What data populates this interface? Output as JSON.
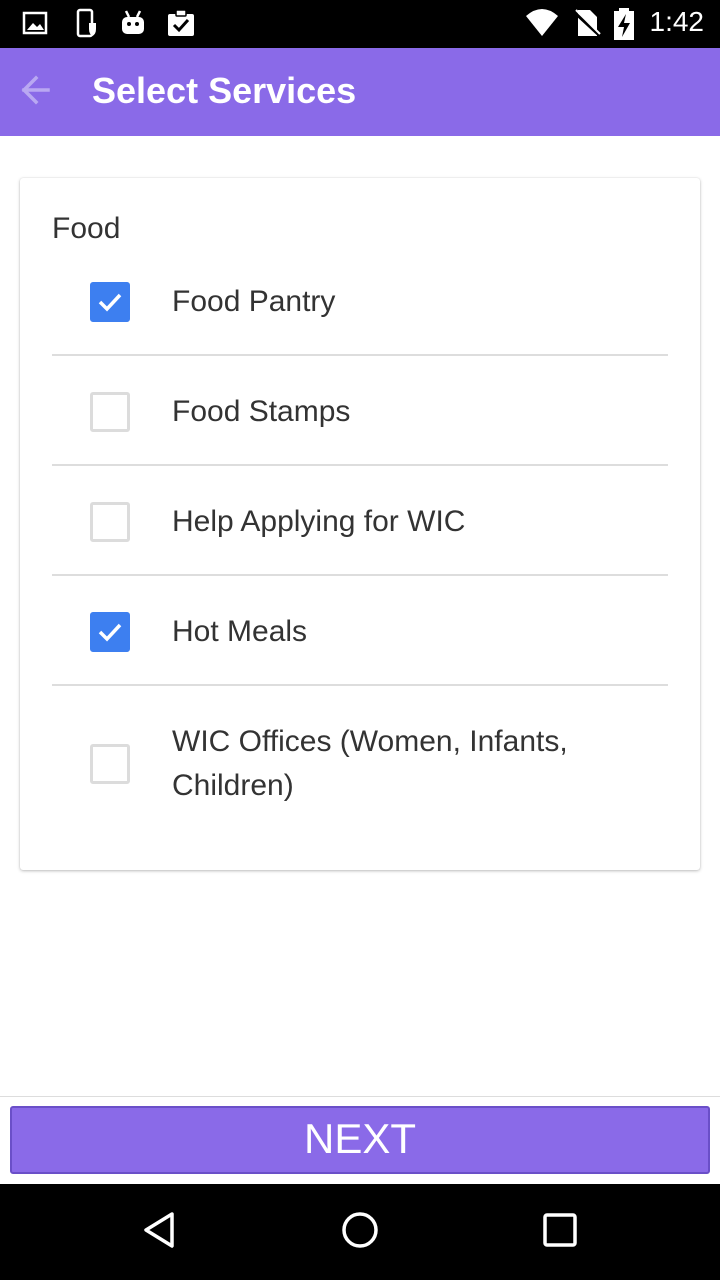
{
  "status_bar": {
    "time": "1:42",
    "icons": [
      "image-icon",
      "phone-shield-icon",
      "android-icon",
      "clipboard-check-icon",
      "wifi-icon",
      "no-sim-icon",
      "battery-charging-icon"
    ]
  },
  "app_bar": {
    "title": "Select Services",
    "back_icon": "arrow-left-icon"
  },
  "section": {
    "title": "Food",
    "items": [
      {
        "label": "Food Pantry",
        "checked": true
      },
      {
        "label": "Food Stamps",
        "checked": false
      },
      {
        "label": "Help Applying for WIC",
        "checked": false
      },
      {
        "label": "Hot Meals",
        "checked": true
      },
      {
        "label": "WIC Offices (Women, Infants, Children)",
        "checked": false
      }
    ]
  },
  "footer": {
    "next_label": "NEXT"
  },
  "nav_bar": {
    "icons": [
      "back-triangle-icon",
      "home-circle-icon",
      "recents-square-icon"
    ]
  },
  "colors": {
    "accent": "#8a6ae8",
    "checkbox_checked": "#3d7ff0"
  }
}
